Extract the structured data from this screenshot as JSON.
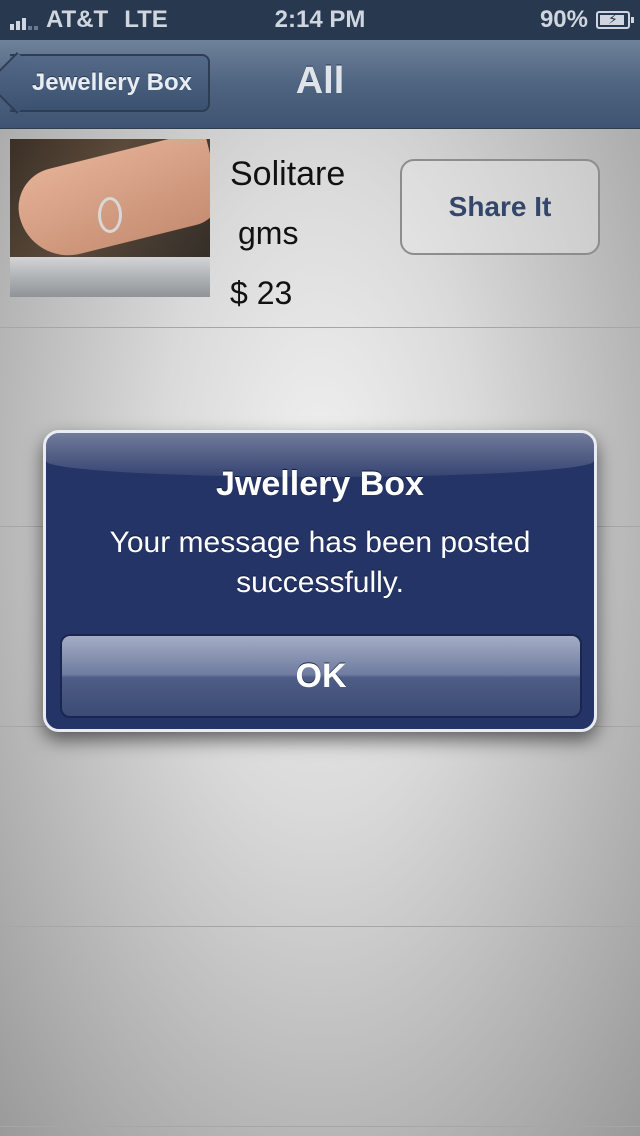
{
  "status_bar": {
    "carrier": "AT&T",
    "network": "LTE",
    "time": "2:14 PM",
    "battery": "90%",
    "battery_level": 0.9,
    "signal_bars": 3
  },
  "nav": {
    "back_label": "Jewellery Box",
    "title": "All"
  },
  "product": {
    "name": "Solitare",
    "weight": "gms",
    "price": "$ 23",
    "share_label": "Share It",
    "image_icon": "ring-photo"
  },
  "alert": {
    "title": "Jwellery Box",
    "message": "Your message has been posted successfully.",
    "ok_label": "OK"
  },
  "colors": {
    "nav_bar": "#4f6480",
    "alert_bg": "#253466",
    "share_text": "#34476b"
  }
}
